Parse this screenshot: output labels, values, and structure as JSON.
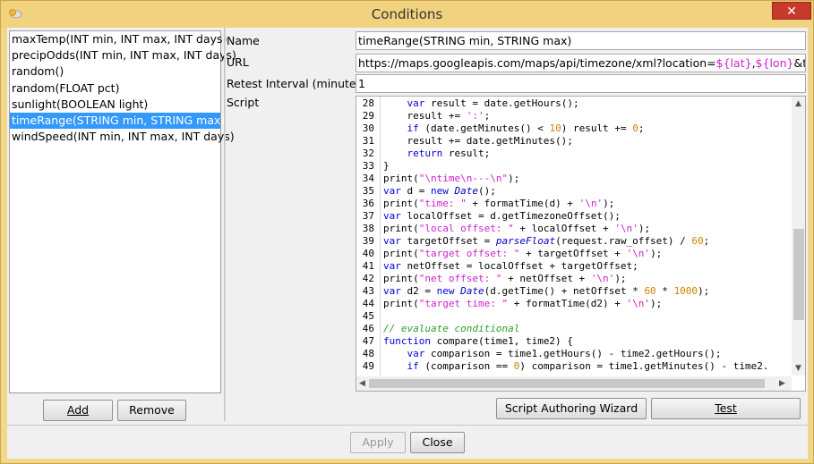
{
  "window": {
    "title": "Conditions",
    "close_glyph": "✕"
  },
  "conditions": {
    "items": [
      "maxTemp(INT min, INT max, INT days)",
      "precipOdds(INT min, INT max, INT days)",
      "random()",
      "random(FLOAT pct)",
      "sunlight(BOOLEAN light)",
      "timeRange(STRING min, STRING max)",
      "windSpeed(INT min, INT max, INT days)"
    ],
    "selected_index": 5,
    "add_label": "Add",
    "remove_label": "Remove"
  },
  "form": {
    "name_label": "Name",
    "name_value": "timeRange(STRING min, STRING max)",
    "url_label": "URL",
    "url_prefix": "https://maps.googleapis.com/maps/api/timezone/xml?location=",
    "url_var_lat": "${lat}",
    "url_sep": ",",
    "url_var_lon": "${lon}",
    "url_suffix": "&timestam",
    "retest_label": "Retest Interval (minutes)",
    "retest_value": "1",
    "script_label": "Script"
  },
  "script": {
    "lines": [
      {
        "n": "28",
        "t": "    var result = date.getHours();"
      },
      {
        "n": "29",
        "t": "    result += ':';"
      },
      {
        "n": "30",
        "t": "    if (date.getMinutes() < 10) result += 0;"
      },
      {
        "n": "31",
        "t": "    result += date.getMinutes();"
      },
      {
        "n": "32",
        "t": "    return result;"
      },
      {
        "n": "33",
        "t": "}"
      },
      {
        "n": "34",
        "t": "print(\"\\ntime\\n---\\n\");"
      },
      {
        "n": "35",
        "t": "var d = new Date();"
      },
      {
        "n": "36",
        "t": "print(\"time: \" + formatTime(d) + '\\n');"
      },
      {
        "n": "37",
        "t": "var localOffset = d.getTimezoneOffset();"
      },
      {
        "n": "38",
        "t": "print(\"local offset: \" + localOffset + '\\n');"
      },
      {
        "n": "39",
        "t": "var targetOffset = parseFloat(request.raw_offset) / 60;"
      },
      {
        "n": "40",
        "t": "print(\"target offset: \" + targetOffset + '\\n');"
      },
      {
        "n": "41",
        "t": "var netOffset = localOffset + targetOffset;"
      },
      {
        "n": "42",
        "t": "print(\"net offset: \" + netOffset + '\\n');"
      },
      {
        "n": "43",
        "t": "var d2 = new Date(d.getTime() + netOffset * 60 * 1000);"
      },
      {
        "n": "44",
        "t": "print(\"target time: \" + formatTime(d2) + '\\n');"
      },
      {
        "n": "45",
        "t": ""
      },
      {
        "n": "46",
        "t": "// evaluate conditional"
      },
      {
        "n": "47",
        "t": "function compare(time1, time2) {"
      },
      {
        "n": "48",
        "t": "    var comparison = time1.getHours() - time2.getHours();"
      },
      {
        "n": "49",
        "t": "    if (comparison == 0) comparison = time1.getMinutes() - time2."
      }
    ]
  },
  "buttons": {
    "wizard_label": "Script Authoring Wizard",
    "test_label": "Test",
    "apply_label": "Apply",
    "close_label": "Close"
  }
}
